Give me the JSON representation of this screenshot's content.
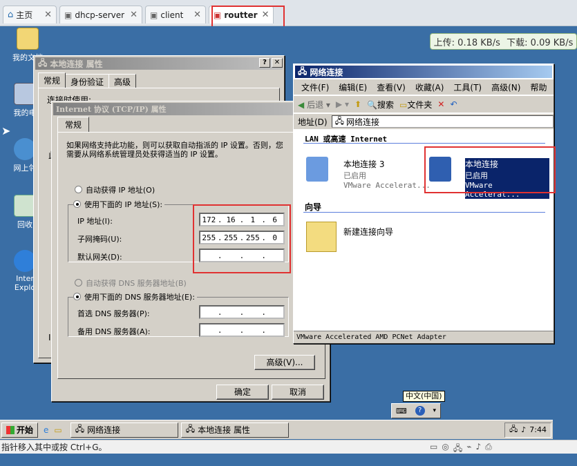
{
  "vm_tabs": [
    {
      "label": "主页"
    },
    {
      "label": "dhcp-server"
    },
    {
      "label": "client"
    },
    {
      "label": "routter"
    }
  ],
  "net_speed": {
    "up": "上传: 0.18 KB/s",
    "down": "下载: 0.09 KB/s"
  },
  "desktop_icons": [
    {
      "label": "我的文档"
    },
    {
      "label": "我的电"
    },
    {
      "label": "网上邻"
    },
    {
      "label": "回收"
    },
    {
      "label": "Inter Explo"
    }
  ],
  "props_dialog": {
    "title": "本地连接 属性",
    "tabs": [
      "常规",
      "身份验证",
      "高级"
    ],
    "partial_text": "连接时使用:",
    "partial_chars": [
      "此",
      "I"
    ]
  },
  "tcpip_dialog": {
    "title": "Internet 协议 (TCP/IP) 属性",
    "tab": "常规",
    "intro": "如果网络支持此功能，则可以获取自动指派的 IP 设置。否则，您需要从网络系统管理员处获得适当的 IP 设置。",
    "auto_ip": "自动获得 IP 地址(O)",
    "use_ip": "使用下面的 IP 地址(S):",
    "ip_label": "IP 地址(I):",
    "mask_label": "子网掩码(U):",
    "gw_label": "默认网关(D):",
    "ip": [
      "172",
      "16",
      "1",
      "6"
    ],
    "mask": [
      "255",
      "255",
      "255",
      "0"
    ],
    "gw": [
      "",
      "",
      "",
      ""
    ],
    "auto_dns": "自动获得 DNS 服务器地址(B)",
    "use_dns": "使用下面的 DNS 服务器地址(E):",
    "dns1_label": "首选 DNS 服务器(P):",
    "dns2_label": "备用 DNS 服务器(A):",
    "advanced": "高级(V)...",
    "ok": "确定",
    "cancel": "取消"
  },
  "netconn": {
    "title": "网络连接",
    "menu": [
      "文件(F)",
      "编辑(E)",
      "查看(V)",
      "收藏(A)",
      "工具(T)",
      "高级(N)",
      "帮助"
    ],
    "back": "后退",
    "search": "搜索",
    "folders": "文件夹",
    "address_label": "地址(D)",
    "address": "网络连接",
    "lan_header": "LAN 或高速 Internet",
    "conn3": {
      "name": "本地连接 3",
      "status": "已启用",
      "device": "VMware Accelerat..."
    },
    "conn1": {
      "name": "本地连接",
      "status": "已启用",
      "device": "VMware Accelerat..."
    },
    "wizard_header": "向导",
    "wizard": "新建连接向导",
    "status": "VMware Accelerated AMD PCNet Adapter"
  },
  "lang_bar": "中文(中国)",
  "taskbar": {
    "start": "开始",
    "task1": "网络连接",
    "task2": "本地连接 属性",
    "clock": "7:44"
  },
  "status_text": "指针移入其中或按 Ctrl+G。"
}
